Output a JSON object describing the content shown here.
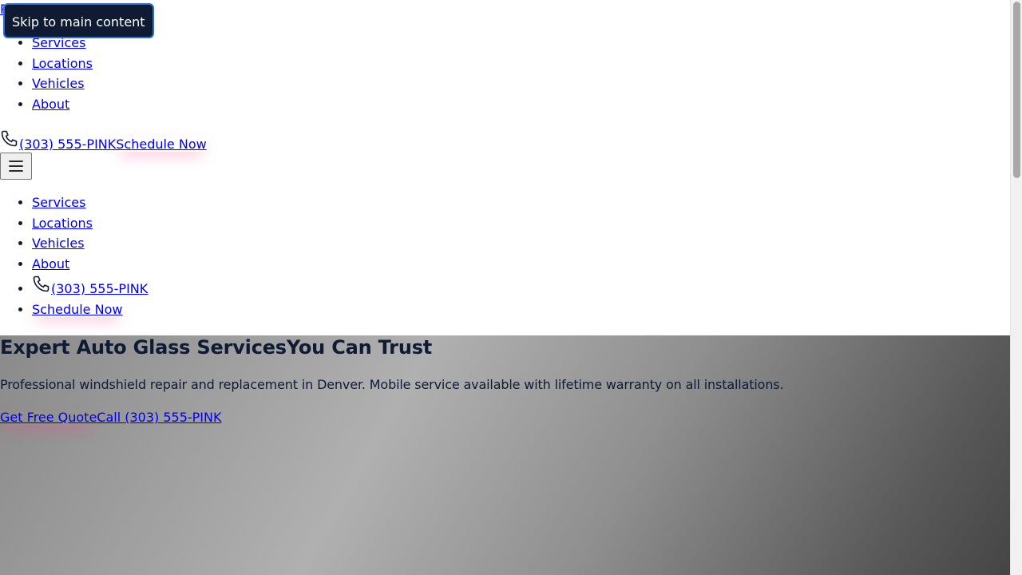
{
  "header": {
    "logo_text": "P",
    "skip_link": "Skip to main content",
    "nav": [
      "Services",
      "Locations",
      "Vehicles",
      "About"
    ],
    "phone_label": "(303) 555-PINK",
    "schedule_label": "Schedule Now",
    "menu_icon": "hamburger-icon"
  },
  "mobile_menu": {
    "nav": [
      "Services",
      "Locations",
      "Vehicles",
      "About"
    ],
    "phone_label": "(303) 555-PINK",
    "schedule_label": "Schedule Now"
  },
  "hero": {
    "title_part1": "Expert Auto Glass Services",
    "title_part2": "You Can Trust",
    "subtitle": "Professional windshield repair and replacement in Denver. Mobile service available with lifetime warranty on all installations.",
    "cta_quote": "Get Free Quote",
    "cta_call": "Call (303) 555-PINK"
  },
  "colors": {
    "skip_bg": "#0f1a33",
    "skip_border": "#2d6fd6",
    "text": "#0f1a33",
    "link": "#0000ee",
    "glow": "#ff3c8c"
  }
}
